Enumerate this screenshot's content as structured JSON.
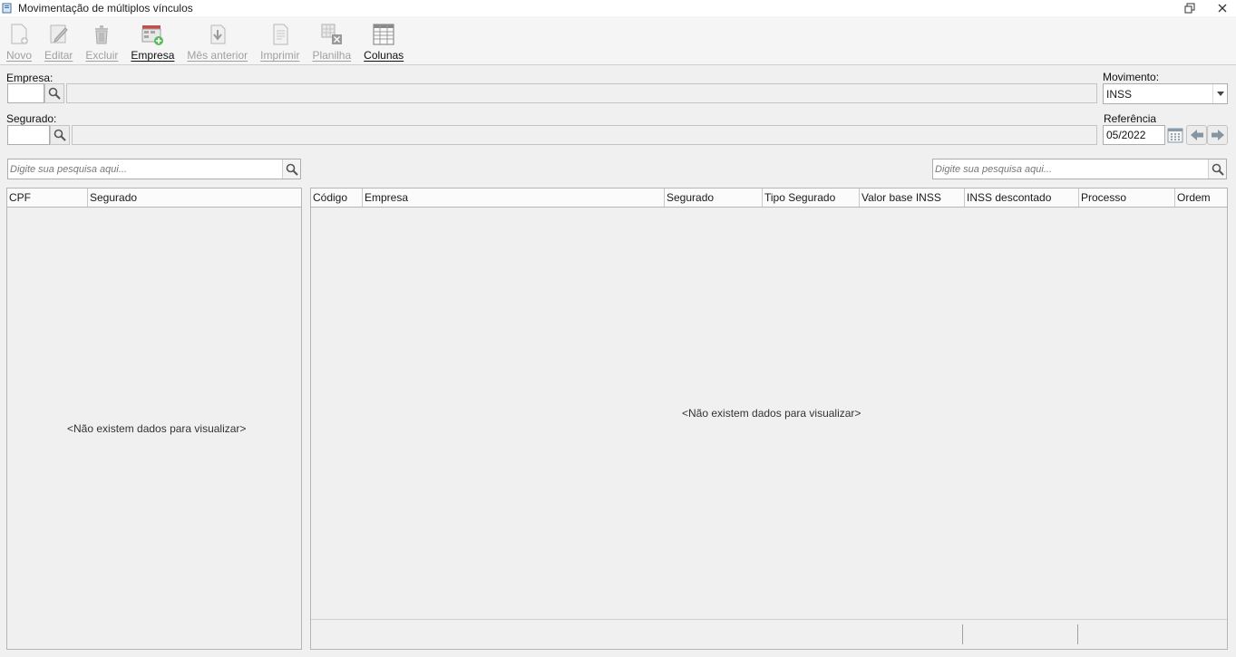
{
  "window": {
    "title": "Movimentação de múltiplos vínculos"
  },
  "toolbar": {
    "buttons": [
      {
        "label": "Novo",
        "icon": "new-document-icon",
        "enabled": false
      },
      {
        "label": "Editar",
        "icon": "edit-icon",
        "enabled": false
      },
      {
        "label": "Excluir",
        "icon": "trash-icon",
        "enabled": false
      },
      {
        "label": "Empresa",
        "icon": "company-add-icon",
        "enabled": true
      },
      {
        "label": "Mês anterior",
        "icon": "previous-month-icon",
        "enabled": false
      },
      {
        "label": "Imprimir",
        "icon": "print-icon",
        "enabled": false
      },
      {
        "label": "Planilha",
        "icon": "spreadsheet-icon",
        "enabled": false
      },
      {
        "label": "Colunas",
        "icon": "columns-icon",
        "enabled": true
      }
    ]
  },
  "form": {
    "empresa": {
      "label": "Empresa:",
      "code": "",
      "name": ""
    },
    "segurado": {
      "label": "Segurado:",
      "code": "",
      "name": ""
    },
    "movimento": {
      "label": "Movimento:",
      "value": "INSS"
    },
    "referencia": {
      "label": "Referência",
      "value": "05/2022"
    }
  },
  "left_panel": {
    "search_placeholder": "Digite sua pesquisa aqui...",
    "columns": [
      "CPF",
      "Segurado"
    ],
    "empty_text": "<Não existem dados para visualizar>"
  },
  "right_panel": {
    "search_placeholder": "Digite sua pesquisa aqui...",
    "columns": [
      "Código",
      "Empresa",
      "Segurado",
      "Tipo Segurado",
      "Valor base INSS",
      "INSS descontado",
      "Processo",
      "Ordem"
    ],
    "empty_text": "<Não existem dados para visualizar>"
  },
  "colors": {
    "background": "#f0f0f0",
    "border": "#b5b5b5",
    "disabled_text": "#a0a0a0"
  }
}
